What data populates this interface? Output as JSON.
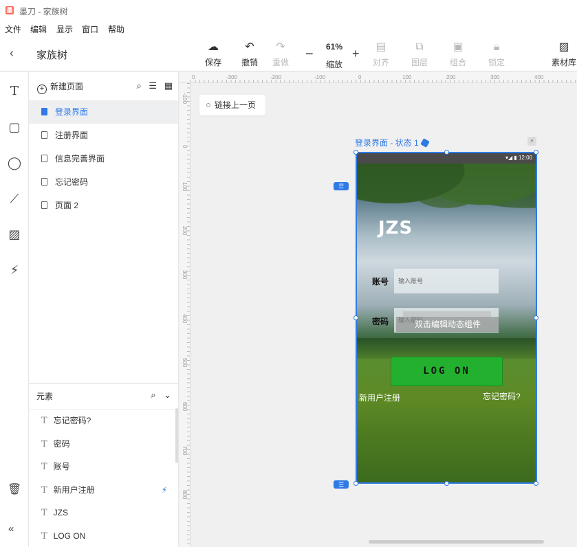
{
  "window": {
    "title": "墨刀 - 家族树",
    "logo_text": "墨"
  },
  "menu": [
    "文件",
    "编辑",
    "显示",
    "窗口",
    "帮助"
  ],
  "toolbar": {
    "project_name": "家族树",
    "save": "保存",
    "undo": "撤销",
    "redo": "重做",
    "zoom_percent": "61%",
    "zoom_label": "缩放",
    "align": "对齐",
    "layer": "图层",
    "group": "组合",
    "lock": "锁定",
    "assets": "素材库"
  },
  "pages_panel": {
    "new_page": "新建页面",
    "pages": [
      {
        "label": "登录界面",
        "active": true
      },
      {
        "label": "注册界面",
        "active": false
      },
      {
        "label": "信息完善界面",
        "active": false
      },
      {
        "label": "忘记密码",
        "active": false
      },
      {
        "label": "页面 2",
        "active": false
      }
    ]
  },
  "elements_panel": {
    "title": "元素",
    "items": [
      {
        "label": "忘记密码?",
        "has_interaction": false
      },
      {
        "label": "密码",
        "has_interaction": false
      },
      {
        "label": "账号",
        "has_interaction": false
      },
      {
        "label": "新用户注册",
        "has_interaction": true
      },
      {
        "label": "JZS",
        "has_interaction": false
      },
      {
        "label": "LOG ON",
        "has_interaction": false
      }
    ]
  },
  "canvas": {
    "ruler_h": [
      "0",
      "-300",
      "-200",
      "-100",
      "0",
      "100",
      "200",
      "300",
      "400"
    ],
    "ruler_v": [
      "-100",
      "0",
      "100",
      "200",
      "300",
      "400",
      "500",
      "600",
      "700",
      "800"
    ],
    "link_prev": "链接上一页",
    "state_label": "登录界面 - 状态 1"
  },
  "phone": {
    "status": "▾◢ ▮ 12:00",
    "logo": "JZS",
    "account_label": "账号",
    "account_placeholder": "输入账号",
    "password_label": "密码",
    "password_placeholder": "输入密码",
    "dynamic_component": "双击编辑动态组件",
    "login_button": "LOG  ON",
    "new_user": "新用户注册",
    "forgot": "忘记密码?"
  },
  "colors": {
    "accent": "#2f7ae5",
    "login_green": "#24b02f"
  }
}
